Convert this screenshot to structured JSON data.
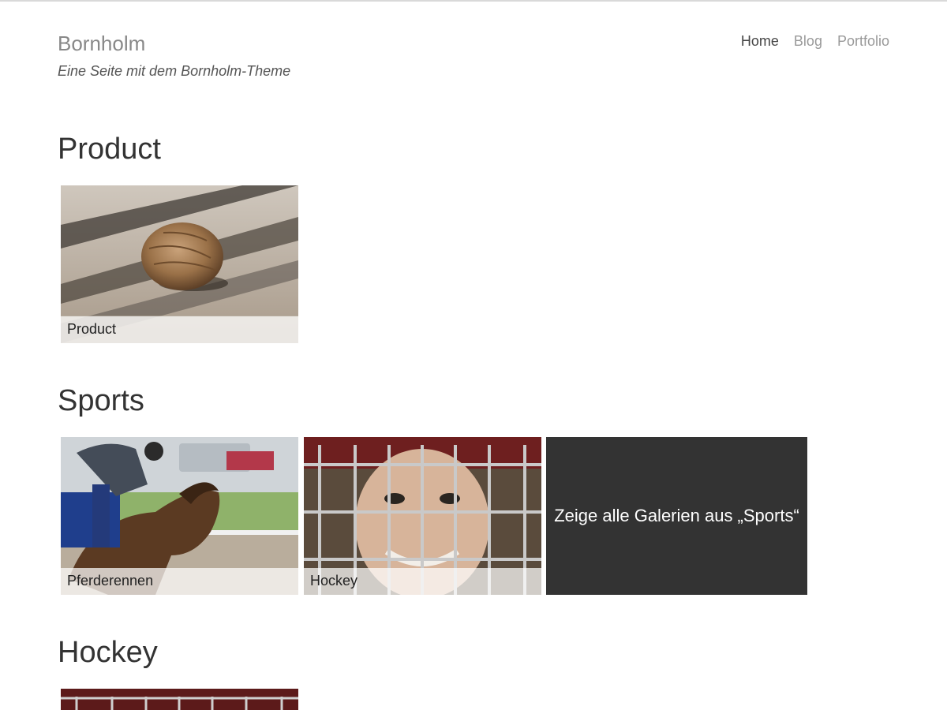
{
  "site": {
    "title": "Bornholm",
    "tagline": "Eine Seite mit dem Bornholm-Theme"
  },
  "nav": {
    "items": [
      {
        "label": "Home",
        "active": true
      },
      {
        "label": "Blog",
        "active": false
      },
      {
        "label": "Portfolio",
        "active": false
      }
    ]
  },
  "sections": [
    {
      "title": "Product",
      "galleries": [
        {
          "caption": "Product",
          "image": "walnut-photo"
        }
      ]
    },
    {
      "title": "Sports",
      "galleries": [
        {
          "caption": "Pferderennen",
          "image": "horse-race-photo"
        },
        {
          "caption": "Hockey",
          "image": "hockey-player-photo"
        }
      ],
      "more_link": "Zeige alle Galerien aus „Sports“"
    },
    {
      "title": "Hockey",
      "galleries": [
        {
          "caption": "",
          "image": "hockey-helmet-photo"
        }
      ]
    }
  ],
  "colors": {
    "more_tile_bg": "#333333",
    "nav_active": "#444444",
    "nav_inactive": "#999999"
  }
}
